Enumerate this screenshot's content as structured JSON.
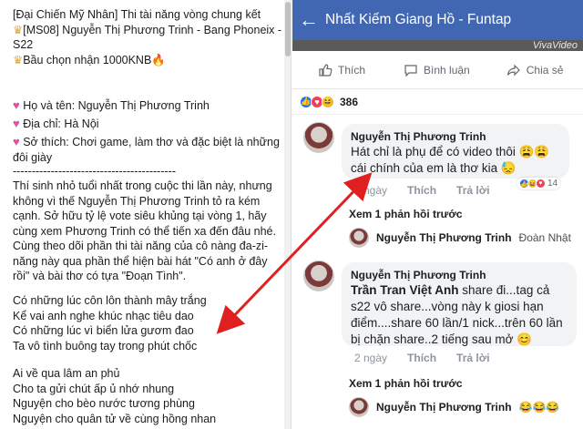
{
  "left_post": {
    "title_line": "[Đại Chiến Mỹ Nhân] Thi tài năng vòng chung kết",
    "ms_line": "[MS08] Nguyễn Thị Phương Trinh - Bang Phoneix - S22",
    "vote_line": "Bầu chọn nhận 1000KNB",
    "name_line": "Họ và tên: Nguyễn Thị Phương Trinh",
    "address_line": "Địa chỉ: Hà Nội",
    "hobby_line": "Sở thích: Chơi game, làm thơ và đặc biệt là những đôi giày",
    "separator": "-------------------------------------------",
    "description": "Thí sinh nhỏ tuổi nhất trong cuộc thi lần này, nhưng không vì thế Nguyễn Thị Phương Trinh tỏ ra kém cạnh. Sở hữu tỷ lệ vote siêu khủng tại vòng 1, hãy cùng xem Phương Trinh có thể tiến xa đến đâu nhé. Cùng theo dõi phần thi tài năng của cô nàng đa-zi-năng này qua phần thể hiện bài hát \"Có anh ở đây rồi\" và bài thơ có tựa \"Đoạn Tình\".",
    "poem_stanza1": [
      "Có những lúc côn lôn thành mây trắng",
      "Kể vai anh nghe khúc nhạc tiêu dao",
      "Có những lúc vì biển lửa gươm đao",
      "Ta vô tình buông tay trong phút chốc"
    ],
    "poem_stanza2": [
      "Ai về qua lâm an phủ",
      "Cho ta gửi chút ấp ủ nhớ nhung",
      "Nguyện cho bèo nước tương phùng",
      "Nguyện cho quân tử về cùng hồng nhan"
    ]
  },
  "fb": {
    "page_title": "Nhất Kiếm Giang Hồ - Funtap",
    "video_watermark": "VivaVideo",
    "actions": {
      "like": "Thích",
      "comment": "Bình luận",
      "share": "Chia sẻ"
    },
    "reaction_count": "386",
    "comment1": {
      "name": "Nguyễn Thị Phương Trinh",
      "text": "Hát chỉ là phụ để có video thôi 😩😩 cái chính của em là thơ kia 😓",
      "time": "2 ngày",
      "like": "Thích",
      "reply": "Trả lời",
      "react_count": "14"
    },
    "view_replies_1": "Xem 1 phản hồi trước",
    "reply1": {
      "name": "Nguyễn Thị Phương Trinh",
      "text": "Đoàn Nhật"
    },
    "comment2": {
      "name": "Nguyễn Thị Phương Trinh",
      "mention": "Trần Tran Việt Anh",
      "text": " share đi...tag cả s22 vô share...vòng này k giosi hạn điểm....share 60 lần/1 nick...trên 60 lần bị chặn share..2 tiếng sau mở 😊",
      "time": "2 ngày",
      "like": "Thích",
      "reply": "Trả lời"
    },
    "view_replies_2": "Xem 1 phản hồi trước",
    "reply2": {
      "name": "Nguyễn Thị Phương Trinh",
      "text": "😂😂😂"
    }
  },
  "colors": {
    "fb_blue": "#4267b2",
    "arrow_red": "#e02020"
  }
}
